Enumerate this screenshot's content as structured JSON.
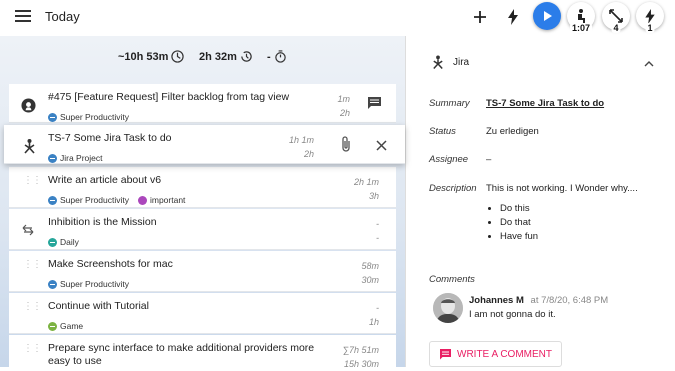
{
  "header": {
    "title": "Today",
    "time_badge": "1:07",
    "count_badge_1": "4",
    "count_badge_2": "1"
  },
  "stats": {
    "estimate": "~10h 53m",
    "spent": "2h 32m",
    "timer": "-"
  },
  "tasks": [
    {
      "title": "#475 [Feature Request] Filter backlog from tag view",
      "project": "Super Productivity",
      "t1": "1m",
      "t2": "2h",
      "icon": "github-icon"
    },
    {
      "title": "TS-7 Some Jira Task to do",
      "project": "Jira Project",
      "t1": "1h 1m",
      "t2": "2h",
      "icon": "jira-icon"
    },
    {
      "title": "Write an article about v6",
      "project": "Super Productivity",
      "tag2": "important",
      "t1": "2h 1m",
      "t2": "3h"
    },
    {
      "title": "Inhibition is the Mission",
      "project": "Daily",
      "t1": "-",
      "t2": "-"
    },
    {
      "title": "Make Screenshots for mac",
      "project": "Super Productivity",
      "t1": "58m",
      "t2": "30m"
    },
    {
      "title": "Continue with Tutorial",
      "project": "Game",
      "t1": "-",
      "t2": "1h"
    },
    {
      "title": "Prepare sync interface to make additional providers more easy to use",
      "t1": "∑7h 51m",
      "t2": "15h 30m"
    }
  ],
  "panel": {
    "title": "Jira",
    "summary_label": "Summary",
    "summary_value": "TS-7 Some Jira Task to do",
    "status_label": "Status",
    "status_value": "Zu erledigen",
    "assignee_label": "Assignee",
    "assignee_value": "–",
    "description_label": "Description",
    "description_value": "This is not working. I Wonder why....",
    "bullets": [
      "Do this",
      "Do that",
      "Have fun"
    ],
    "comments_label": "Comments",
    "comment_author": "Johannes M",
    "comment_date": "at 7/8/20, 6:48 PM",
    "comment_text": "I am not gonna do it.",
    "write_comment": "WRITE A COMMENT"
  },
  "colors": {
    "accent": "#2b7de9",
    "pink": "#e91e63",
    "project_blue": "#3b82c4",
    "daily_teal": "#26a69a",
    "game_green": "#7cb342",
    "important_purple": "#ab47bc"
  }
}
